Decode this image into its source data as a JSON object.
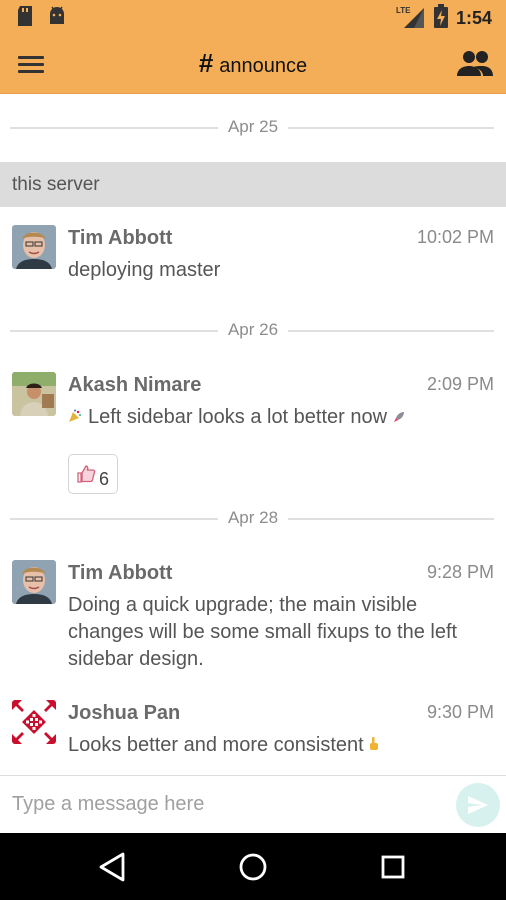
{
  "status_bar": {
    "time": "1:54",
    "network": "LTE",
    "icons": [
      "sd-card-icon",
      "android-icon",
      "signal-icon",
      "battery-charging-icon"
    ]
  },
  "app_bar": {
    "channel_prefix": "#",
    "channel_name": "announce",
    "icons": [
      "menu-icon",
      "people-icon"
    ]
  },
  "topic_header": "this server",
  "date_separators": [
    "Apr 25",
    "Apr 26",
    "Apr 28"
  ],
  "messages": [
    {
      "sender": "Tim Abbott",
      "time": "10:02 PM",
      "text": "deploying master"
    },
    {
      "sender": "Akash Nimare",
      "time": "2:09 PM",
      "text": "Left sidebar looks a lot better now",
      "reaction": {
        "emoji": "thumbs-up",
        "count": "6"
      }
    },
    {
      "sender": "Tim Abbott",
      "time": "9:28 PM",
      "text": "Doing a quick upgrade; the main visible changes will be some small fixups to the left sidebar design."
    },
    {
      "sender": "Joshua Pan",
      "time": "9:30 PM",
      "text": "Looks better and more consistent"
    }
  ],
  "composer": {
    "placeholder": "Type a message here"
  },
  "colors": {
    "app_bar": "#f4ae57",
    "send_button": "#d6f1ee",
    "navbar": "#000000"
  }
}
